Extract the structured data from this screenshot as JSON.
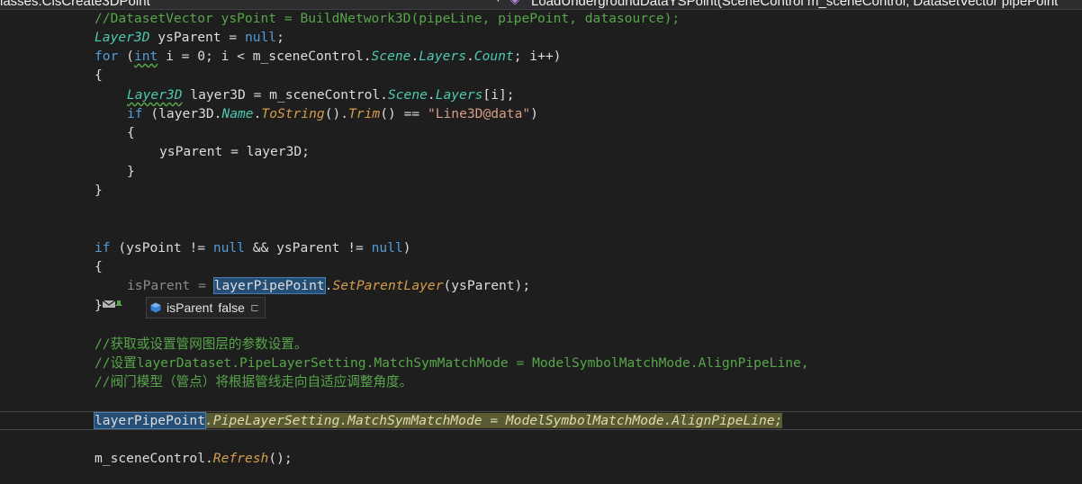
{
  "tabs": {
    "class_selector": "lasses.CisCreate3DPoint",
    "method_selector": "LoadUndergroundDataYSPoint(SceneControl m_sceneControl, DatasetVector pipePoint"
  },
  "code": {
    "l1": "//DatasetVector ysPoint = BuildNetwork3D(pipeLine, pipePoint, datasource);",
    "l2_type": "Layer3D",
    "l2_rest": " ysParent = ",
    "l2_null": "null",
    "l3_for": "for",
    "l3_a": " (",
    "l3_int": "int",
    "l3_b": " i = 0; i < m_sceneControl.",
    "l3_scene": "Scene",
    "l3_dot1": ".",
    "l3_layers": "Layers",
    "l3_dot2": ".",
    "l3_count": "Count",
    "l3_c": "; i++)",
    "brace_open": "{",
    "brace_close": "}",
    "l5_type": "Layer3D",
    "l5_a": " layer3D = m_sceneControl.",
    "l5_scene": "Scene",
    "l5_dot": ".",
    "l5_layers": "Layers",
    "l5_b": "[i];",
    "l6_if": "if",
    "l6_a": " (layer3D.",
    "l6_name": "Name",
    "l6_dot1": ".",
    "l6_tostring": "ToString",
    "l6_b": "().",
    "l6_trim": "Trim",
    "l6_c": "() == ",
    "l6_str": "\"Line3D@data\"",
    "l6_d": ")",
    "l8": "ysParent = layer3D;",
    "l12_if": "if",
    "l12_a": " (ysPoint != ",
    "l12_null1": "null",
    "l12_b": " && ysParent != ",
    "l12_null2": "null",
    "l12_c": ")",
    "l14_var": "isParent",
    "l14_eq": " = ",
    "l14_ref": "layerPipePoint",
    "l14_dot": ".",
    "l14_method": "SetParentLayer",
    "l14_args": "(ysParent);",
    "c1": "//获取或设置管网图层的参数设置。",
    "c2": "//设置layerDataset.PipeLayerSetting.MatchSymMatchMode = ModelSymbolMatchMode.AlignPipeLine,",
    "c3": "//阀门模型（管点）将根据管线走向自适应调整角度。",
    "l20_ref": "layerPipePoint",
    "l20_rest": ".PipeLayerSetting.MatchSymMatchMode = ModelSymbolMatchMode.AlignPipeLine;",
    "l22_a": "m_sceneControl.",
    "l22_method": "Refresh",
    "l22_b": "();"
  },
  "datatip": {
    "name": "isParent",
    "value": "false",
    "icon": "field-cube-icon",
    "pin": "⊏"
  },
  "colors": {
    "keyword": "#569cd6",
    "comment": "#57a64a",
    "type": "#4ec9b0",
    "string": "#d69d85",
    "method": "#dcdcaa",
    "background": "#1e1e1e"
  }
}
